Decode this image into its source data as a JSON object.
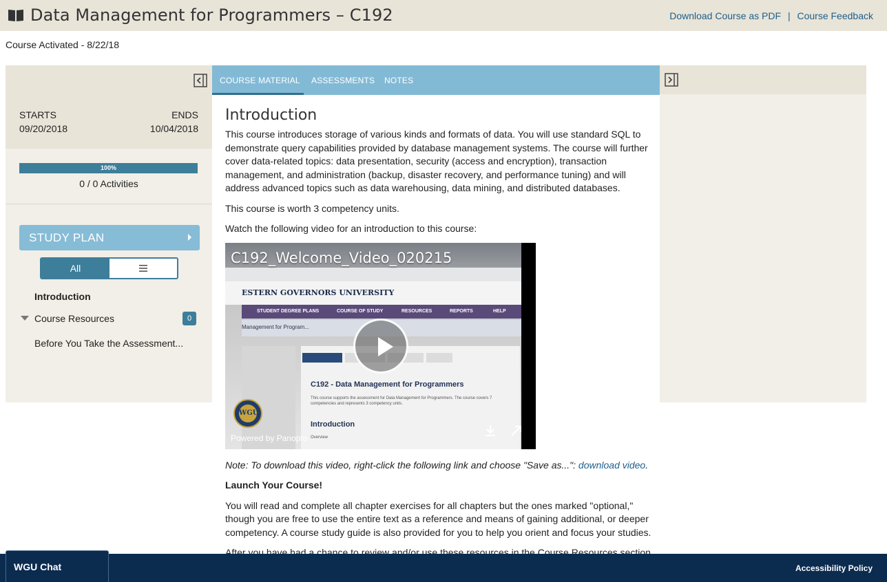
{
  "header": {
    "title": "Data Management for Programmers – C192",
    "download_pdf": "Download Course as PDF",
    "separator": "|",
    "feedback": "Course Feedback",
    "book_icon": "book-icon"
  },
  "activated": "Course Activated - 8/22/18",
  "sidebar": {
    "starts_label": "STARTS",
    "starts_value": "09/20/2018",
    "ends_label": "ENDS",
    "ends_value": "10/04/2018",
    "progress": {
      "percent": 100,
      "label": "100%"
    },
    "activities": "0 / 0 Activities",
    "study_plan": "STUDY PLAN",
    "toggle_all": "All",
    "items": [
      {
        "label": "Introduction",
        "bold": true
      },
      {
        "label": "Course Resources",
        "badge": "0",
        "expandable": true
      },
      {
        "label": "Before You Take the Assessment..."
      }
    ]
  },
  "tabs": [
    {
      "label": "COURSE MATERIAL",
      "active": true
    },
    {
      "label": "ASSESSMENTS"
    },
    {
      "label": "NOTES"
    }
  ],
  "content": {
    "heading": "Introduction",
    "p1": "This course introduces storage of various kinds and formats of data. You will use standard SQL to demonstrate query capabilities provided by database management systems. The course will further cover data-related topics: data presentation, security (access and encryption), transaction management, and administration (backup, disaster recovery, and performance tuning) and will address advanced topics such as data warehousing, data mining, and distributed databases.",
    "p2": "This course is worth 3 competency units.",
    "p3": "Watch the following video for an introduction to this course:",
    "video": {
      "title": "C192_Welcome_Video_020215",
      "powered_by": "Powered by Panopto",
      "inner_university": "ESTERN GOVERNORS UNIVERSITY",
      "inner_nav": [
        "STUDENT DEGREE PLANS",
        "COURSE OF STUDY",
        "RESOURCES",
        "REPORTS",
        "HELP"
      ],
      "inner_breadcrumb": "Management for Program...",
      "inner_course_title": "C192 - Data Management for Programmers",
      "inner_desc": "This course supports the assessment for Data Management for Programmers. The course covers 7 competencies and represents 3 competency units.",
      "inner_intro": "Introduction",
      "inner_overview": "Overview",
      "seal_text": "WGU"
    },
    "note_prefix": "Note: To download this video, right-click the following link and choose \"Save as...\": ",
    "note_link": "download video",
    "note_suffix": ".",
    "launch": "Launch Your Course!",
    "p4": "You will read and complete all chapter exercises for all chapters but the ones marked \"optional,\" though you are free to use the entire text as a reference and means of gaining additional, or deeper competency. A course study guide is also provided for you to help you orient and focus your studies.",
    "p5": "After you have had a chance to review and/or use these resources in the Course Resources section"
  },
  "footer": {
    "chat": "WGU Chat",
    "accessibility": "Accessibility Policy"
  },
  "colors": {
    "header_bg": "#e8e4d8",
    "tab_bar": "#82bad6",
    "accent": "#3d7e9a",
    "link": "#1e5f8c",
    "footer_bg": "#0b2b4f"
  }
}
